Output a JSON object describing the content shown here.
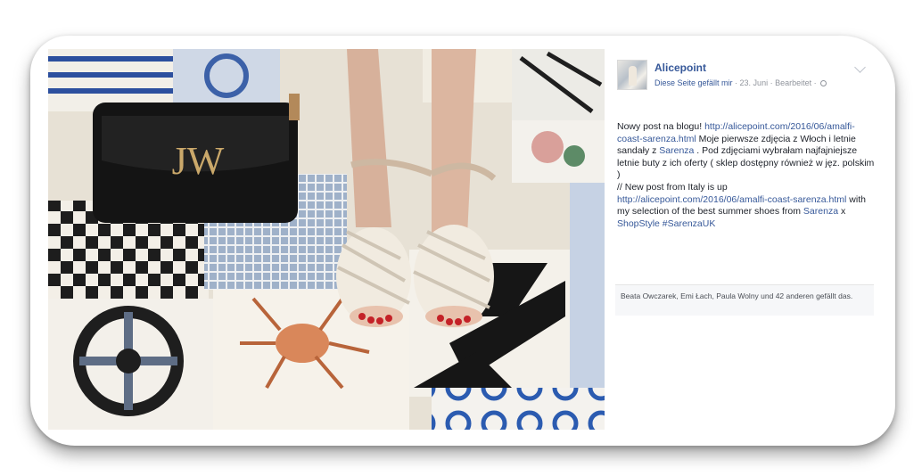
{
  "post": {
    "page_name": "Alicepoint",
    "like_page": "Diese Seite gefällt mir",
    "date": "23. Juni",
    "edited": "Bearbeitet",
    "meta_sep": " · ",
    "text": {
      "p1": "Nowy post na blogu! ",
      "link1": "http://alicepoint.com/2016/06/amalfi-coast-sarenza.html",
      "p2": " Moje pierwsze zdjęcia z Włoch i letnie sandały z ",
      "tag1": "Sarenza",
      "p3": " . Pod zdjęciami wybrałam najfajniejsze letnie buty z ich oferty ( sklep dostępny również w jęz. polskim )",
      "p4": "// New post from Italy is up ",
      "link2": "http://alicepoint.com/2016/06/amalfi-coast-sarenza.html",
      "p5": " with my selection of the best summer shoes from ",
      "tag2": "Sarenza",
      "p6": " x ",
      "tag3": "ShopStyle",
      "p7": " ",
      "hashtag": "#SarenzaUK"
    },
    "likes": "Beata Owczarek, Emi Łach, Paula Wolny und 42 anderen gefällt das."
  },
  "photo": {
    "subject": "Tiled floor with black handbag and white strappy sandals",
    "brand_mark": "JW"
  },
  "colors": {
    "link": "#365899",
    "meta": "#90949c",
    "text": "#1d2129",
    "tile_blue": "#2f4f9a",
    "bag": "#141414"
  }
}
